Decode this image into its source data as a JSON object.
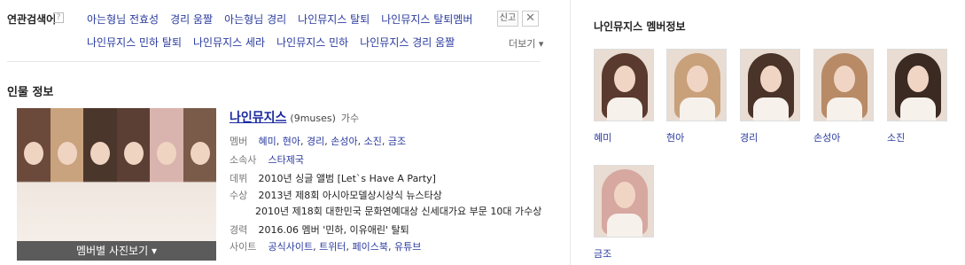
{
  "related": {
    "label": "연관검색어",
    "help": "?",
    "row1": [
      "아는형님 전효성",
      "경리 움짤",
      "아는형님 경리",
      "나인뮤지스 탈퇴",
      "나인뮤지스 탈퇴멤버"
    ],
    "row2": [
      "나인뮤지스 민하 탈퇴",
      "나인뮤지스 세라",
      "나인뮤지스 민하",
      "나인뮤지스 경리 움짤"
    ],
    "report": "신고",
    "close": "✕",
    "more": "더보기 ▾"
  },
  "person": {
    "section_title": "인물 정보",
    "photo_button": "멤버별 사진보기 ▾",
    "name": "나인뮤지스",
    "name_en": "(9muses)",
    "type": "가수",
    "members_label": "멤버",
    "members": [
      "혜미",
      "현아",
      "경리",
      "손성아",
      "소진",
      "금조"
    ],
    "agency_label": "소속사",
    "agency": "스타제국",
    "debut_label": "데뷔",
    "debut": "2010년 싱글 앨범 [Let`s Have A Party]",
    "award_label": "수상",
    "awards": [
      "2013년 제8회 아시아모델상시상식 뉴스타상",
      "2010년 제18회 대한민국 문화연예대상 신세대가요 부문 10대 가수상"
    ],
    "career_label": "경력",
    "career": "2016.06 멤버 '민하, 이유애린' 탈퇴",
    "site_label": "사이트",
    "sites": [
      "공식사이트",
      "트위터",
      "페이스북",
      "유튜브"
    ]
  },
  "members_panel": {
    "title": "나인뮤지스 멤버정보",
    "members": [
      {
        "name": "혜미",
        "hair": "#5a3a2e"
      },
      {
        "name": "현아",
        "hair": "#c8a07a"
      },
      {
        "name": "경리",
        "hair": "#4a3328"
      },
      {
        "name": "손성아",
        "hair": "#b88a66"
      },
      {
        "name": "소진",
        "hair": "#3a2a22"
      },
      {
        "name": "금조",
        "hair": "#d6a8a0"
      }
    ]
  },
  "photo_strips": [
    "#6b4a3c",
    "#c9a27e",
    "#4b362c",
    "#5c3f34",
    "#d9b3ad",
    "#7a5a48"
  ]
}
